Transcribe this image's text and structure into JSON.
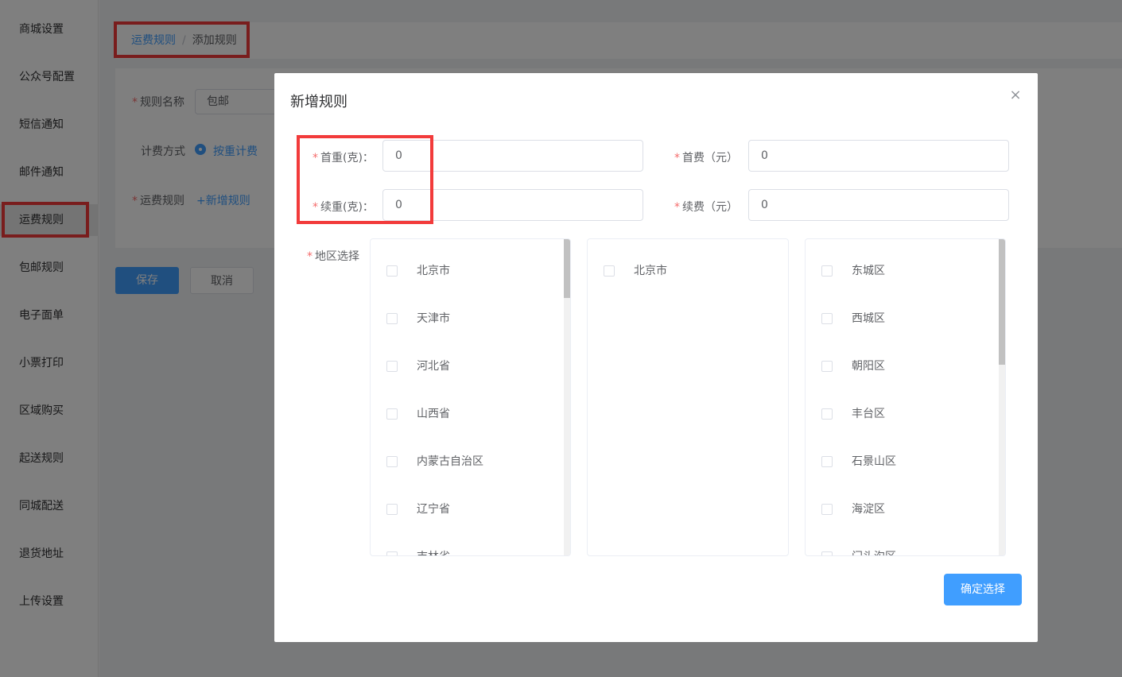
{
  "sidebar": {
    "items": [
      {
        "label": "商城设置"
      },
      {
        "label": "公众号配置"
      },
      {
        "label": "短信通知"
      },
      {
        "label": "邮件通知"
      },
      {
        "label": "运费规则"
      },
      {
        "label": "包邮规则"
      },
      {
        "label": "电子面单"
      },
      {
        "label": "小票打印"
      },
      {
        "label": "区域购买"
      },
      {
        "label": "起送规则"
      },
      {
        "label": "同城配送"
      },
      {
        "label": "退货地址"
      },
      {
        "label": "上传设置"
      }
    ]
  },
  "breadcrumb": {
    "parent": "运费规则",
    "separator": "/",
    "current": "添加规则"
  },
  "form": {
    "required_mark": "*",
    "rule_name_label": "规则名称",
    "rule_name_value": "包邮",
    "billing_label": "计费方式",
    "billing_option": "按重计费",
    "freight_rule_label": "运费规则",
    "add_rule_link": "+新增规则",
    "save_button": "保存",
    "cancel_button": "取消"
  },
  "dialog": {
    "title": "新增规则",
    "close": "×",
    "first_weight_label": "首重(克)：",
    "first_weight_value": "0",
    "extra_weight_label": "续重(克)：",
    "extra_weight_value": "0",
    "first_fee_label": "首费（元）",
    "first_fee_value": "0",
    "extra_fee_label": "续费（元）",
    "extra_fee_value": "0",
    "region_label": "地区选择",
    "provinces": [
      "北京市",
      "天津市",
      "河北省",
      "山西省",
      "内蒙古自治区",
      "辽宁省",
      "吉林省"
    ],
    "cities": [
      "北京市"
    ],
    "districts": [
      "东城区",
      "西城区",
      "朝阳区",
      "丰台区",
      "石景山区",
      "海淀区",
      "门头沟区"
    ],
    "confirm_button": "确定选择"
  },
  "colors": {
    "accent": "#409eff",
    "highlight": "#f23b3b",
    "required": "#f56c6c"
  }
}
